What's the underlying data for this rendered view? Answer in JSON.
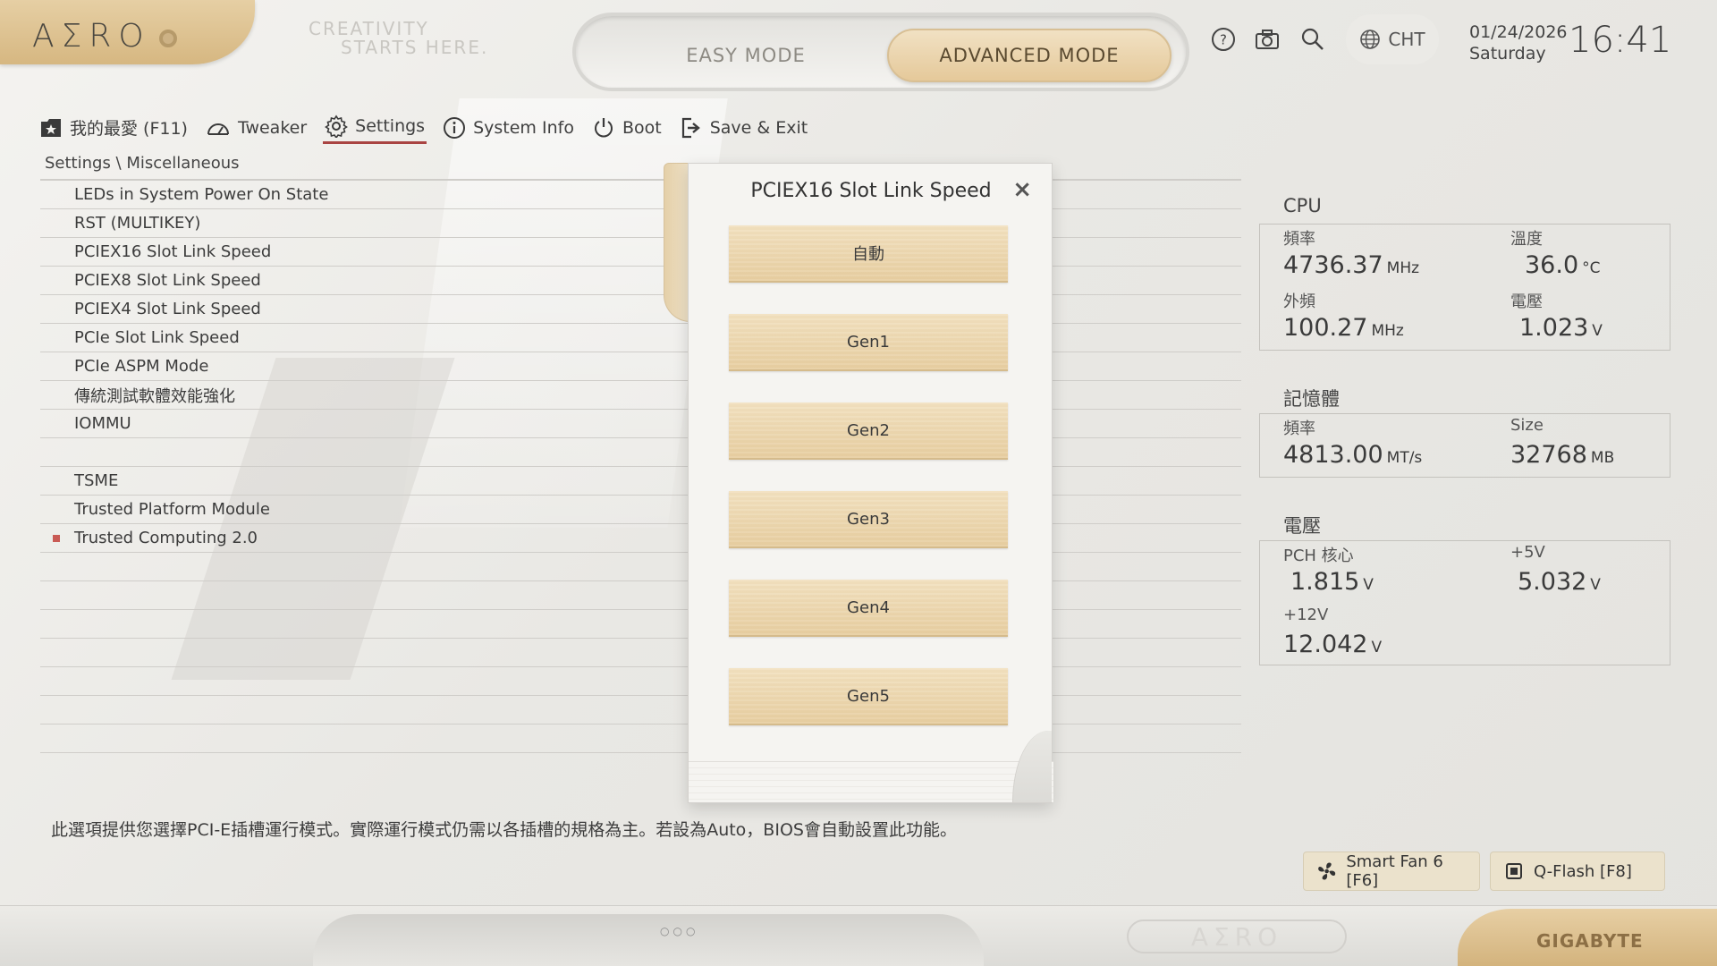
{
  "header": {
    "logo": "AΣRO",
    "tagline": [
      "CREATIVITY",
      "STARTS HERE."
    ],
    "modes": {
      "easy": "EASY MODE",
      "advanced": "ADVANCED MODE"
    },
    "icons": [
      "help-icon",
      "camera-icon",
      "search-icon",
      "globe-icon"
    ],
    "language": "CHT",
    "date": "01/24/2026",
    "weekday": "Saturday",
    "time": "16:41"
  },
  "nav": [
    {
      "label": "我的最愛 (F11)",
      "icon": "favorites-icon"
    },
    {
      "label": "Tweaker",
      "icon": "gauge-icon"
    },
    {
      "label": "Settings",
      "icon": "gear-icon"
    },
    {
      "label": "System Info",
      "icon": "info-icon"
    },
    {
      "label": "Boot",
      "icon": "power-icon"
    },
    {
      "label": "Save & Exit",
      "icon": "exit-icon"
    }
  ],
  "breadcrumb": "Settings \\ Miscellaneous",
  "settings": [
    "LEDs in System Power On State",
    "RST (MULTIKEY)",
    "PCIEX16 Slot Link Speed",
    "PCIEX8 Slot Link Speed",
    "PCIEX4 Slot Link Speed",
    "PCIe Slot Link Speed",
    "PCIe ASPM Mode",
    "傳統測試軟體效能強化",
    "IOMMU",
    "",
    "TSME",
    "Trusted Platform Module",
    "Trusted Computing 2.0"
  ],
  "description": "此選項提供您選擇PCI-E插槽運行模式。實際運行模式仍需以各插槽的規格為主。若設為Auto，BIOS會自動設置此功能。",
  "modal": {
    "title": "PCIEX16 Slot Link Speed",
    "close": "×",
    "options": [
      "自動",
      "Gen1",
      "Gen2",
      "Gen3",
      "Gen4",
      "Gen5"
    ]
  },
  "monitor": {
    "cpu": {
      "title": "CPU",
      "freq_label": "頻率",
      "freq": "4736.37",
      "freq_unit": "MHz",
      "temp_label": "溫度",
      "temp": "36.0",
      "temp_unit": "°C",
      "bclk_label": "外頻",
      "bclk": "100.27",
      "bclk_unit": "MHz",
      "volt_label": "電壓",
      "volt": "1.023",
      "volt_unit": "V"
    },
    "memory": {
      "title": "記憶體",
      "freq_label": "頻率",
      "freq": "4813.00",
      "freq_unit": "MT/s",
      "size_label": "Size",
      "size": "32768",
      "size_unit": "MB"
    },
    "voltage": {
      "title": "電壓",
      "pch_label": "PCH 核心",
      "pch": "1.815",
      "pch_unit": "V",
      "v5_label": "+5V",
      "v5": "5.032",
      "v5_unit": "V",
      "v12_label": "+12V",
      "v12": "12.042",
      "v12_unit": "V"
    }
  },
  "footer": {
    "smartfan": "Smart Fan 6 [F6]",
    "qflash": "Q-Flash [F8]",
    "brand": "GIGABYTE",
    "bottom_logo": "AΣRO"
  },
  "colors": {
    "accent": "#a94442",
    "wood": "#e7cea1",
    "panel": "#f5f4f1"
  }
}
